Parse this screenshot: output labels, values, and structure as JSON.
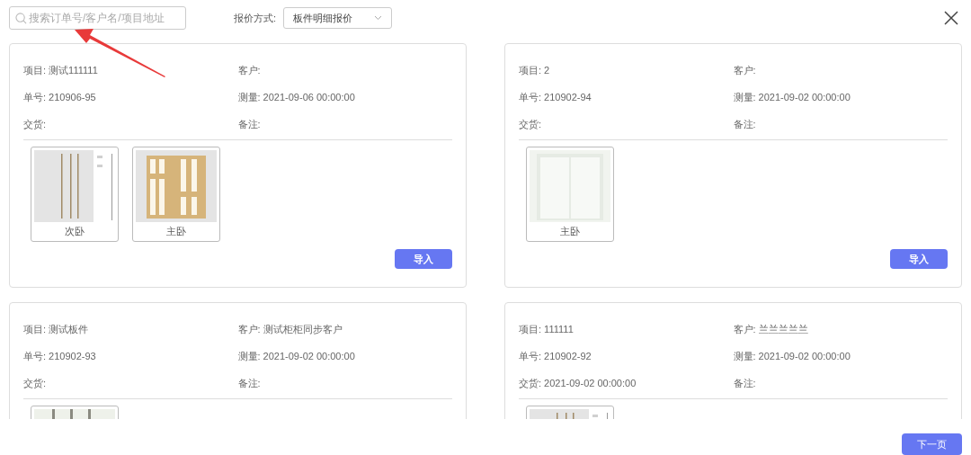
{
  "search": {
    "placeholder": "搜索订单号/客户名/项目地址"
  },
  "quote_mode": {
    "label": "报价方式:",
    "value": "板件明细报价"
  },
  "orders": [
    {
      "fields": [
        {
          "label": "项目:",
          "value": "测试111111"
        },
        {
          "label": "客户:"
        },
        {
          "label": "单号:",
          "value": "210906-95"
        },
        {
          "label": "测量:",
          "value": "2021-09-06 00:00:00"
        },
        {
          "label": "交货:"
        },
        {
          "label": "备注:"
        }
      ],
      "thumbnails": [
        {
          "kind": "captioned",
          "label": "次卧"
        },
        {
          "kind": "captioned",
          "label": "主卧"
        }
      ],
      "button": "导入"
    },
    {
      "fields": [
        {
          "label": "项目:",
          "value": "2"
        },
        {
          "label": "客户:"
        },
        {
          "label": "单号:",
          "value": "210902-94"
        },
        {
          "label": "测量:",
          "value": "2021-09-02 00:00:00"
        },
        {
          "label": "交货:"
        },
        {
          "label": "备注:"
        }
      ],
      "thumbnails": [
        {
          "kind": "captioned",
          "label": "主卧"
        }
      ],
      "button": "导入"
    },
    {
      "fields": [
        {
          "label": "项目:",
          "value": "测试板件"
        },
        {
          "label": "客户:",
          "value": "测试柜柜同步客户"
        },
        {
          "label": "单号:",
          "value": "210902-93"
        },
        {
          "label": "测量:",
          "value": "2021-09-02 00:00:00"
        },
        {
          "label": "交货:"
        },
        {
          "label": "备注:"
        }
      ]
    },
    {
      "fields": [
        {
          "label": "项目:",
          "value": "111111"
        },
        {
          "label": "客户:",
          "value": "兰兰兰兰兰"
        },
        {
          "label": "单号:",
          "value": "210902-92"
        },
        {
          "label": "测量:",
          "value": "2021-09-02 00:00:00"
        },
        {
          "label": "交货:",
          "value": "2021-09-02 00:00:00"
        },
        {
          "label": "备注:"
        }
      ]
    }
  ],
  "next_button": "下一页"
}
